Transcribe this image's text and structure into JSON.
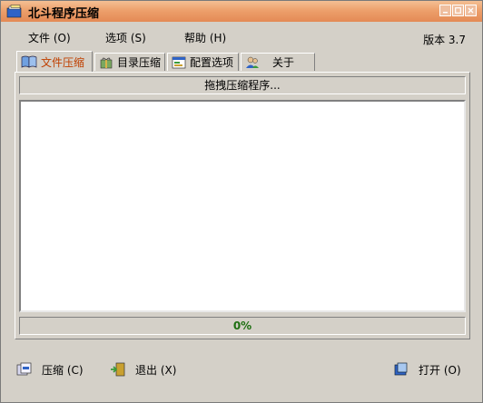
{
  "window": {
    "title": "北斗程序压缩"
  },
  "menu": {
    "items": [
      {
        "label": "文件 (O)"
      },
      {
        "label": "选项 (S)"
      },
      {
        "label": "帮助 (H)"
      }
    ],
    "version": "版本 3.7"
  },
  "tabs": [
    {
      "label": "文件压缩",
      "icon": "book-icon",
      "active": true
    },
    {
      "label": "目录压缩",
      "icon": "gift-box-icon",
      "active": false
    },
    {
      "label": "配置选项",
      "icon": "config-window-icon",
      "active": false
    },
    {
      "label": "关于",
      "icon": "users-icon",
      "active": false
    }
  ],
  "panel": {
    "drop_label": "拖拽压缩程序...",
    "progress_text": "0%",
    "progress_value": 0
  },
  "buttons": {
    "compress": "压缩 (C)",
    "exit": "退出 (X)",
    "open": "打开 (O)"
  },
  "colors": {
    "titlebar": "#e48a55",
    "active_tab": "#c04000",
    "progress_text": "#1e6f12"
  }
}
